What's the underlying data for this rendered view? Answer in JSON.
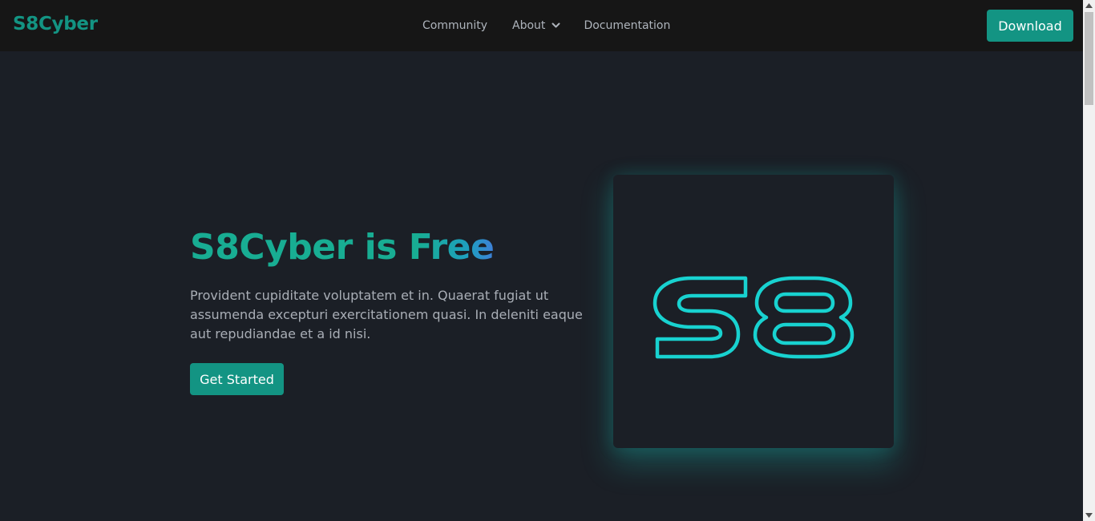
{
  "navbar": {
    "brand": "S8Cyber",
    "links": [
      {
        "label": "Community"
      },
      {
        "label": "About",
        "has_dropdown": true,
        "icon": "chevron-down-icon"
      },
      {
        "label": "Documentation"
      }
    ],
    "download_label": "Download"
  },
  "hero": {
    "title": "S8Cyber is Free",
    "description": "Provident cupiditate voluptatem et in. Quaerat fugiat ut assumenda excepturi exercitationem quasi. In deleniti eaque aut repudiandae et a id nisi.",
    "cta_label": "Get Started",
    "logo": {
      "text": "S8",
      "icon": "s8-logo",
      "outline_color": "#18d2d0"
    }
  },
  "colors": {
    "accent": "#139483",
    "background": "#1b1f26",
    "navbar_bg": "#161616"
  }
}
